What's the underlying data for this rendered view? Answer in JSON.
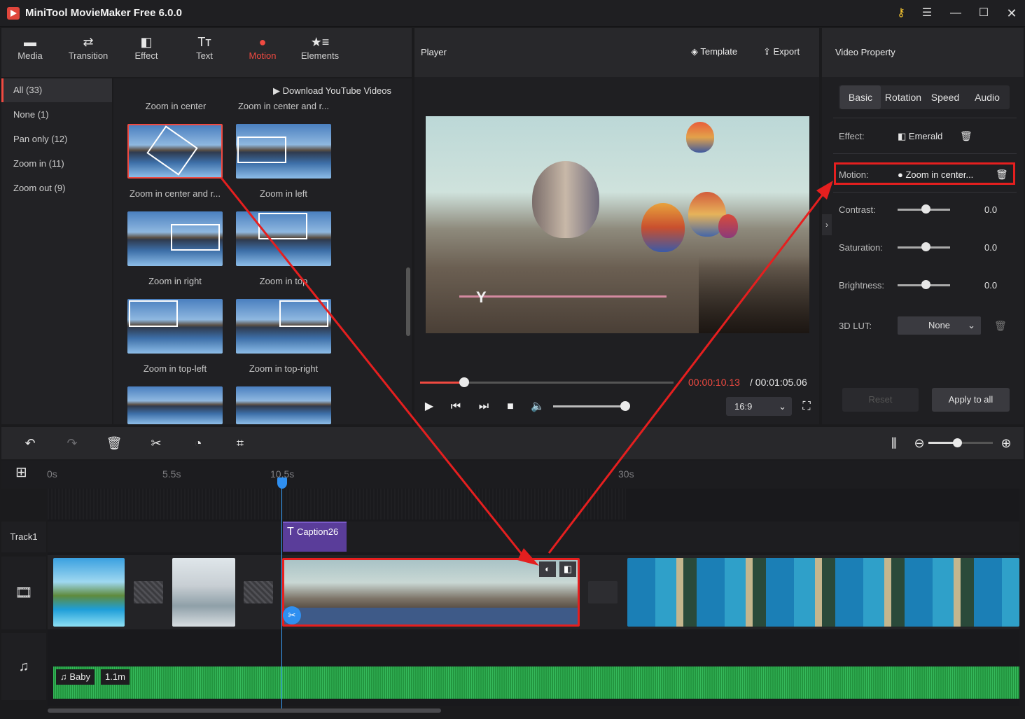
{
  "app": {
    "title": "MiniTool MovieMaker Free 6.0.0"
  },
  "title_icons": [
    "key-icon",
    "menu-icon",
    "minimize-icon",
    "maximize-icon",
    "close-icon"
  ],
  "toolbar": {
    "items": [
      {
        "label": "Media",
        "icon": "media-icon"
      },
      {
        "label": "Transition",
        "icon": "transition-icon"
      },
      {
        "label": "Effect",
        "icon": "effect-icon"
      },
      {
        "label": "Text",
        "icon": "text-icon"
      },
      {
        "label": "Motion",
        "icon": "motion-icon"
      },
      {
        "label": "Elements",
        "icon": "elements-icon"
      }
    ],
    "active": "Motion"
  },
  "categories": [
    {
      "label": "All (33)"
    },
    {
      "label": "None (1)"
    },
    {
      "label": "Pan only (12)"
    },
    {
      "label": "Zoom in (11)"
    },
    {
      "label": "Zoom out (9)"
    }
  ],
  "library": {
    "download_label": "Download YouTube Videos",
    "top_labels": [
      "Zoom in center",
      "Zoom in center and r..."
    ],
    "items": [
      {
        "label": "Zoom in center and r..."
      },
      {
        "label": "Zoom in left"
      },
      {
        "label": "Zoom in right"
      },
      {
        "label": "Zoom in top"
      },
      {
        "label": "Zoom in top-left"
      },
      {
        "label": "Zoom in top-right"
      }
    ]
  },
  "player": {
    "title": "Player",
    "template_label": "Template",
    "export_label": "Export",
    "progress": 0.16,
    "current_time": "00:00:10.13",
    "total_time": "/ 00:01:05.06",
    "volume": 0.92,
    "aspect_ratio": "16:9",
    "overlay_text": "Y"
  },
  "property": {
    "title": "Video Property",
    "tabs": [
      "Basic",
      "Rotation",
      "Speed",
      "Audio"
    ],
    "active_tab": "Basic",
    "effect_label": "Effect:",
    "effect_value": "Emerald",
    "motion_label": "Motion:",
    "motion_value": "Zoom in center...",
    "contrast_label": "Contrast:",
    "contrast_value": "0.0",
    "saturation_label": "Saturation:",
    "saturation_value": "0.0",
    "brightness_label": "Brightness:",
    "brightness_value": "0.0",
    "lut_label": "3D LUT:",
    "lut_value": "None",
    "reset_label": "Reset",
    "apply_label": "Apply to all"
  },
  "timeline": {
    "ruler": [
      "0s",
      "5.5s",
      "10.5s",
      "30s"
    ],
    "track1_label": "Track1",
    "caption_label": "Caption26",
    "audio_name": "Baby",
    "audio_length": "1.1m",
    "zoom_level": 0.55
  },
  "colors": {
    "accent": "#f04a41",
    "highlight": "#e51f1f",
    "playhead": "#2f8ff0",
    "audio": "#2aa44d",
    "caption": "#5a3d9a"
  }
}
